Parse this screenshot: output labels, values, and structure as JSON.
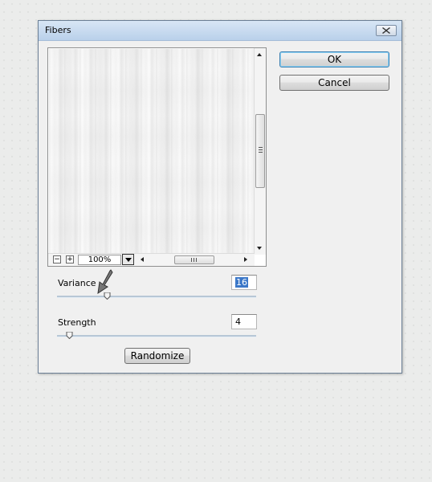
{
  "window": {
    "title": "Fibers"
  },
  "preview": {
    "zoom": "100%"
  },
  "buttons": {
    "ok": "OK",
    "cancel": "Cancel",
    "randomize": "Randomize"
  },
  "params": {
    "variance": {
      "label": "Variance",
      "value": "16",
      "slider_fraction": 0.25
    },
    "strength": {
      "label": "Strength",
      "value": "4",
      "slider_fraction": 0.06
    }
  },
  "icons": {
    "close": "close-icon",
    "zoom_out": "minus-icon",
    "zoom_in": "plus-icon",
    "zoom_dropdown": "chevron-down-icon",
    "cursor": "mouse-pointer-icon"
  }
}
